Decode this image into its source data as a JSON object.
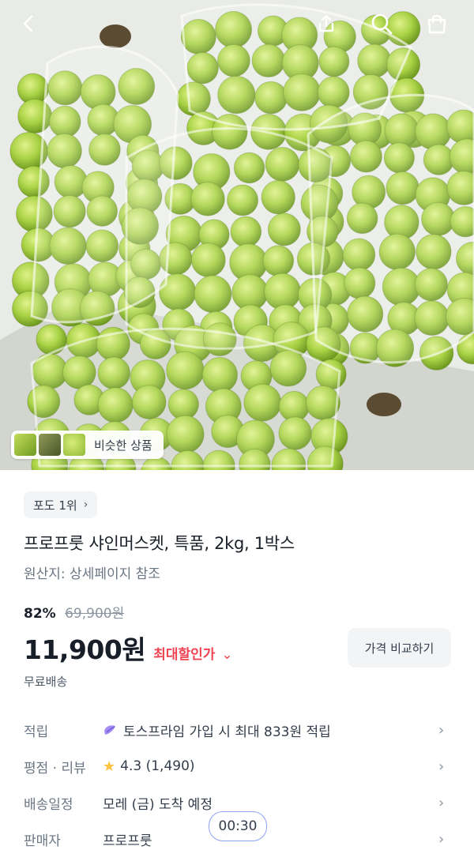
{
  "topbar": {
    "back_icon": "back-arrow-icon",
    "share_icon": "share-icon",
    "search_icon": "search-icon",
    "cart_icon": "shopping-bag-icon"
  },
  "hero": {
    "similar_products_label": "비슷한 상품"
  },
  "product": {
    "rank_badge": "포도 1위",
    "title": "프로프룻 샤인머스켓, 특품, 2kg, 1박스",
    "origin": "원산지: 상세페이지 참조",
    "discount_percent": "82%",
    "original_price": "69,900원",
    "price": "11,900원",
    "max_discount_label": "최대할인가",
    "compare_button": "가격 비교하기",
    "shipping": "무료배송"
  },
  "info_rows": [
    {
      "label": "적립",
      "value": "토스프라임 가입 시 최대 833원 적립"
    },
    {
      "label": "평점 · 리뷰",
      "rating": "4.3",
      "count": "(1,490)"
    },
    {
      "label": "배송일정",
      "value": "모레 (금) 도착 예정"
    },
    {
      "label": "판매자",
      "value": "프로프룻"
    }
  ],
  "overlay": {
    "timer": "00:30"
  },
  "colors": {
    "accent_red": "#f04452",
    "star": "#ffc342",
    "grape": "#9bc93a"
  }
}
